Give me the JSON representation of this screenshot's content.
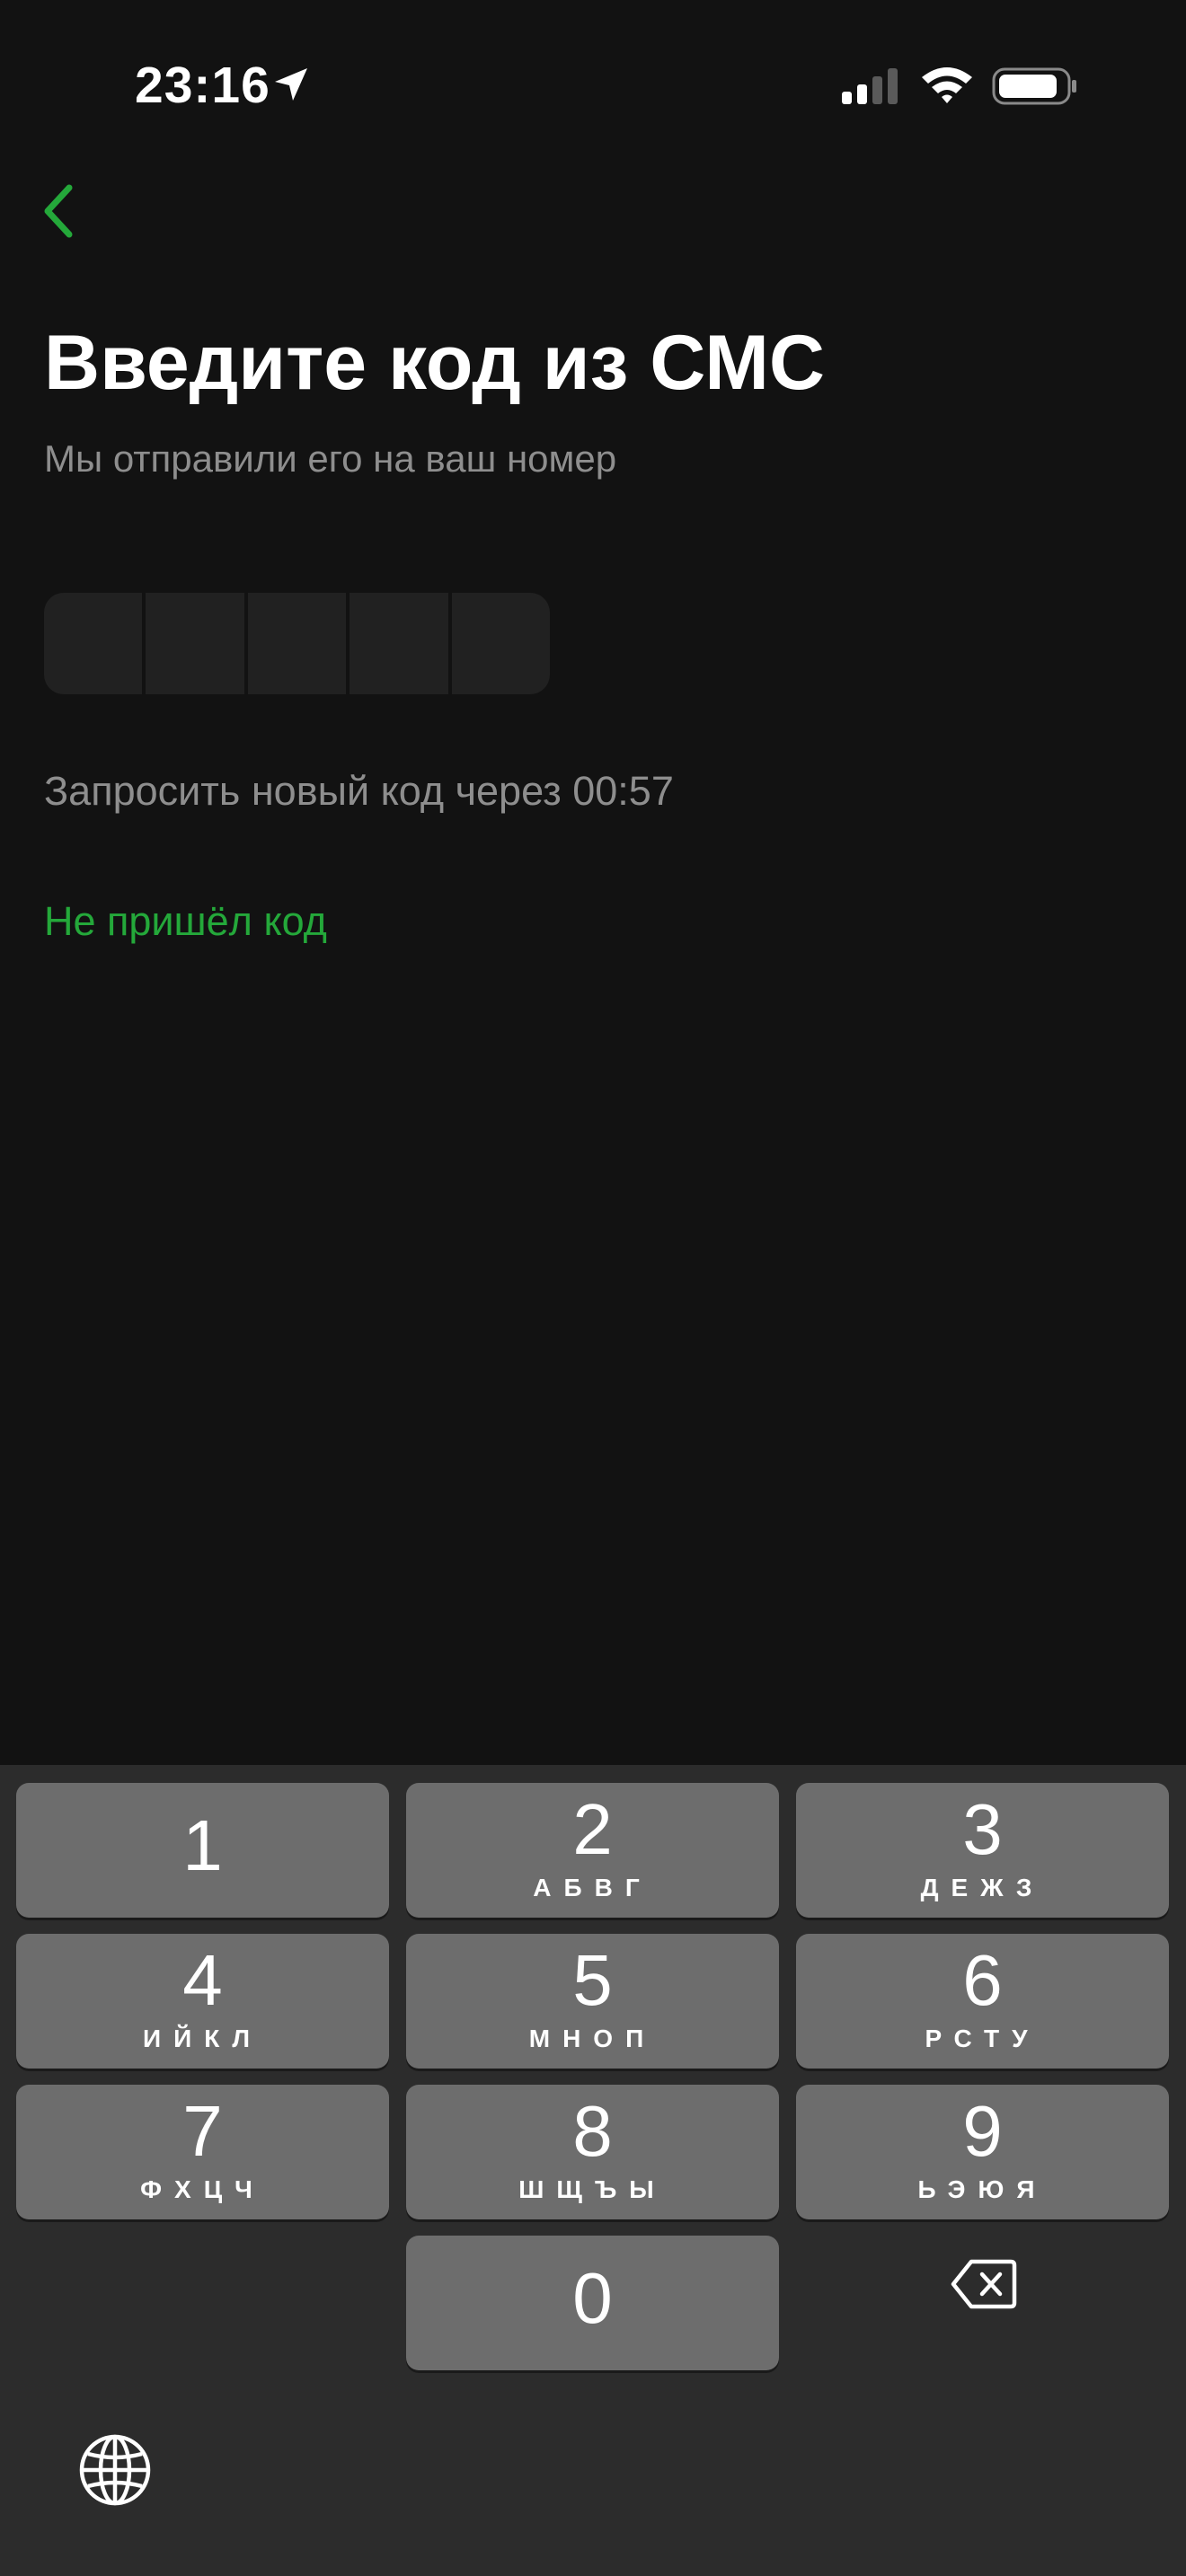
{
  "status_bar": {
    "time": "23:16",
    "icons": [
      "location-arrow-icon",
      "cellular-signal-icon",
      "wifi-icon",
      "battery-icon"
    ]
  },
  "navigation": {
    "back_icon": "chevron-left-icon",
    "accent_color": "#24a83a"
  },
  "content": {
    "title": "Введите код из СМС",
    "subtitle": "Мы отправили его на ваш номер",
    "code_length": 5,
    "resend_timer": "Запросить новый код через 00:57",
    "no_code_link": "Не пришёл код"
  },
  "keyboard": {
    "keys": [
      {
        "digit": "1",
        "letters": ""
      },
      {
        "digit": "2",
        "letters": "АБВГ"
      },
      {
        "digit": "3",
        "letters": "ДЕЖЗ"
      },
      {
        "digit": "4",
        "letters": "ИЙКЛ"
      },
      {
        "digit": "5",
        "letters": "МНОП"
      },
      {
        "digit": "6",
        "letters": "РСТУ"
      },
      {
        "digit": "7",
        "letters": "ФХЦЧ"
      },
      {
        "digit": "8",
        "letters": "ШЩЪЫ"
      },
      {
        "digit": "9",
        "letters": "ЬЭЮЯ"
      },
      {
        "digit": "0",
        "letters": ""
      }
    ],
    "backspace_icon": "backspace-icon",
    "globe_icon": "globe-icon"
  }
}
